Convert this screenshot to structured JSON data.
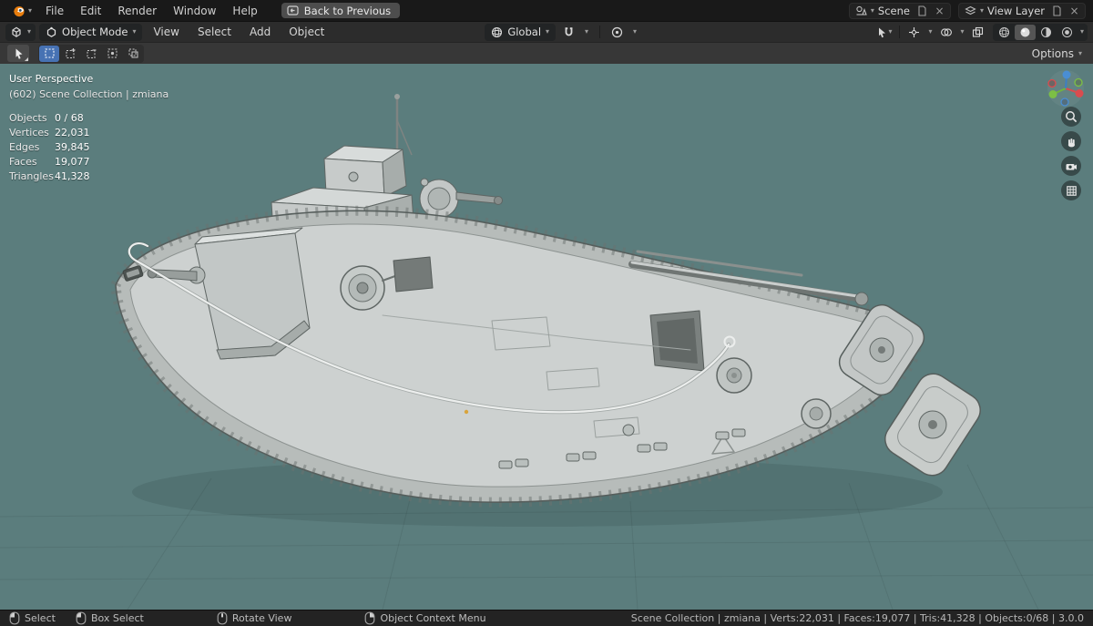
{
  "icons": {
    "chevron_down": "▾",
    "close": "×"
  },
  "topbar": {
    "menus": [
      "File",
      "Edit",
      "Render",
      "Window",
      "Help"
    ],
    "back_button": "Back to Previous",
    "scene": {
      "label": "Scene"
    },
    "view_layer": {
      "label": "View Layer"
    }
  },
  "header": {
    "mode": "Object Mode",
    "menus": [
      "View",
      "Select",
      "Add",
      "Object"
    ],
    "orientation": "Global"
  },
  "tool_header": {
    "options_label": "Options"
  },
  "viewport": {
    "perspective_label": "User Perspective",
    "collection_label": "(602) Scene Collection | zmiana",
    "stats": [
      {
        "label": "Objects",
        "value": "0 / 68"
      },
      {
        "label": "Vertices",
        "value": "22,031"
      },
      {
        "label": "Edges",
        "value": "39,845"
      },
      {
        "label": "Faces",
        "value": "19,077"
      },
      {
        "label": "Triangles",
        "value": "41,328"
      }
    ]
  },
  "statusbar": {
    "hints": [
      "Select",
      "Box Select",
      "Rotate View",
      "Object Context Menu"
    ],
    "info": "Scene Collection | zmiana | Verts:22,031 | Faces:19,077 | Tris:41,328 | Objects:0/68 | 3.0.0"
  },
  "colors": {
    "accent_blue": "#4772b3",
    "viewport_background": "#5b7d7d",
    "model_gray": "#cdd1d0",
    "blender_orange": "#e87d0d"
  }
}
